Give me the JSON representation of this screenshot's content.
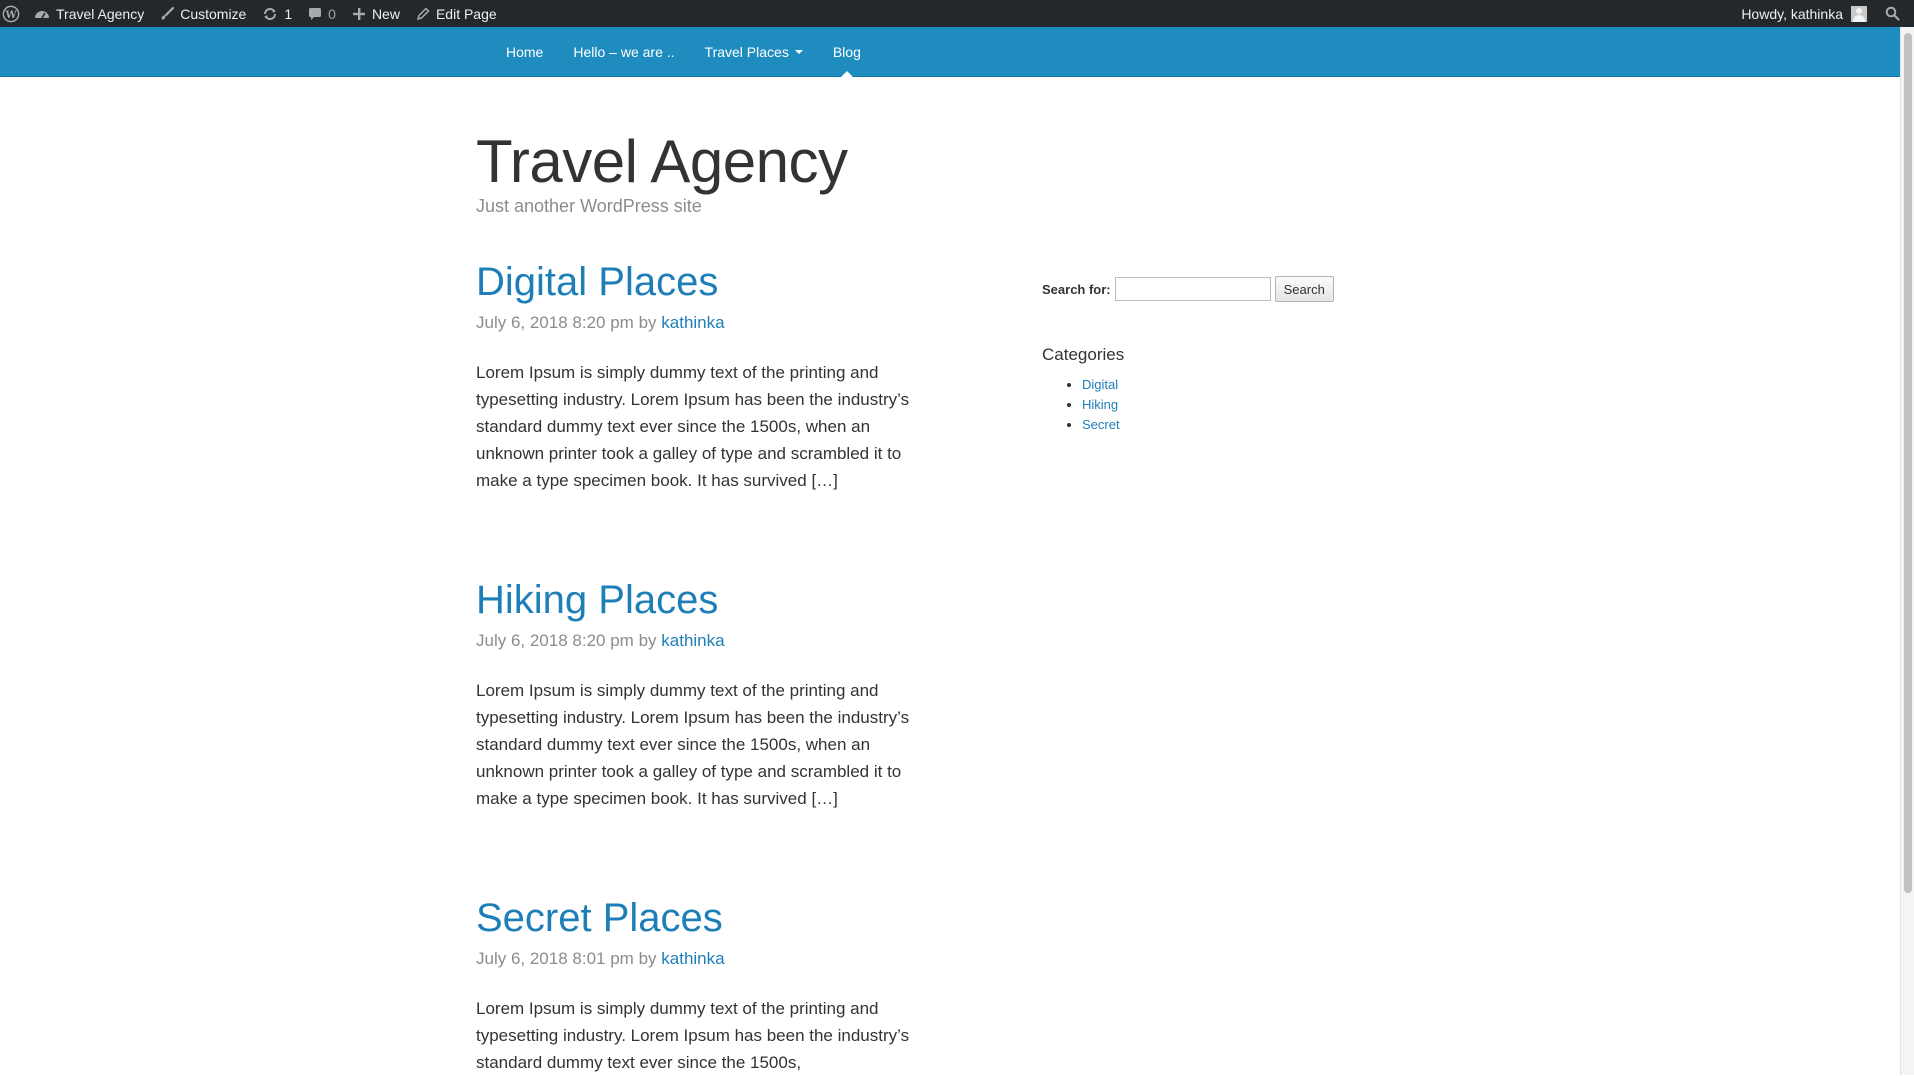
{
  "admin_bar": {
    "site_name": "Travel Agency",
    "customize": "Customize",
    "updates_count": "1",
    "comments_count": "0",
    "new": "New",
    "edit_page": "Edit Page",
    "howdy": "Howdy, kathinka",
    "icons": [
      "wordpress-logo-icon",
      "dashboard-icon",
      "paintbrush-icon",
      "updates-icon",
      "comment-icon",
      "plus-icon",
      "pencil-icon",
      "user-avatar",
      "search-icon"
    ]
  },
  "nav": {
    "items": [
      {
        "label": "Home"
      },
      {
        "label": "Hello – we are .."
      },
      {
        "label": "Travel Places"
      },
      {
        "label": "Blog"
      }
    ],
    "current": "Blog",
    "background": "#1e8cbe"
  },
  "header": {
    "title": "Travel Agency",
    "tagline": "Just another WordPress site"
  },
  "posts": [
    {
      "title": "Digital Places",
      "date": "July 6, 2018 8:20 pm",
      "by": "by",
      "author": "kathinka",
      "excerpt": "Lorem Ipsum is simply dummy text of the printing and typesetting industry. Lorem Ipsum has been the industry’s standard dummy text ever since the 1500s, when an unknown printer took a galley of type and scrambled it to make a type specimen book. It has survived […]"
    },
    {
      "title": "Hiking Places",
      "date": "July 6, 2018 8:20 pm",
      "by": "by",
      "author": "kathinka",
      "excerpt": "Lorem Ipsum is simply dummy text of the printing and typesetting industry. Lorem Ipsum has been the industry’s standard dummy text ever since the 1500s, when an unknown printer took a galley of type and scrambled it to make a type specimen book. It has survived […]"
    },
    {
      "title": "Secret Places",
      "date": "July 6, 2018 8:01 pm",
      "by": "by",
      "author": "kathinka",
      "excerpt": "Lorem Ipsum is simply dummy text of the printing and typesetting industry. Lorem Ipsum has been the industry’s standard dummy text ever since the 1500s,"
    }
  ],
  "sidebar": {
    "search_label": "Search for:",
    "search_value": "",
    "search_button": "Search",
    "categories_heading": "Categories",
    "categories": [
      "Digital",
      "Hiking",
      "Secret"
    ]
  },
  "colors": {
    "admin_bar": "#23282d",
    "link": "#1e7fb8",
    "meta_text": "#8c8c8c"
  }
}
